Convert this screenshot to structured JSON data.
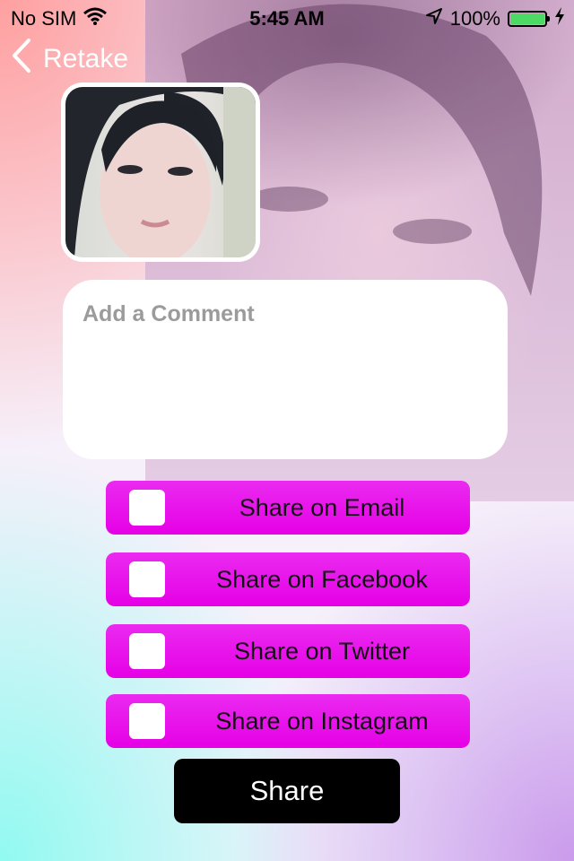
{
  "status_bar": {
    "carrier": "No SIM",
    "time": "5:45 AM",
    "battery_percent": "100%",
    "battery_level": 1.0
  },
  "nav": {
    "back_label": "Retake"
  },
  "comment": {
    "placeholder": "Add a Comment",
    "value": ""
  },
  "share_options": [
    {
      "label": "Share on Email",
      "checked": false
    },
    {
      "label": "Share on Facebook",
      "checked": false
    },
    {
      "label": "Share on Twitter",
      "checked": false
    },
    {
      "label": "Share on Instagram",
      "checked": false
    }
  ],
  "share_button": {
    "label": "Share"
  },
  "colors": {
    "option_bg": "#e600e6",
    "share_button_bg": "#000000",
    "battery_fill": "#4cd964"
  },
  "icons": [
    "wifi-icon",
    "location-arrow-icon",
    "battery-icon",
    "charging-bolt-icon",
    "chevron-left-icon",
    "checkbox-icon"
  ]
}
